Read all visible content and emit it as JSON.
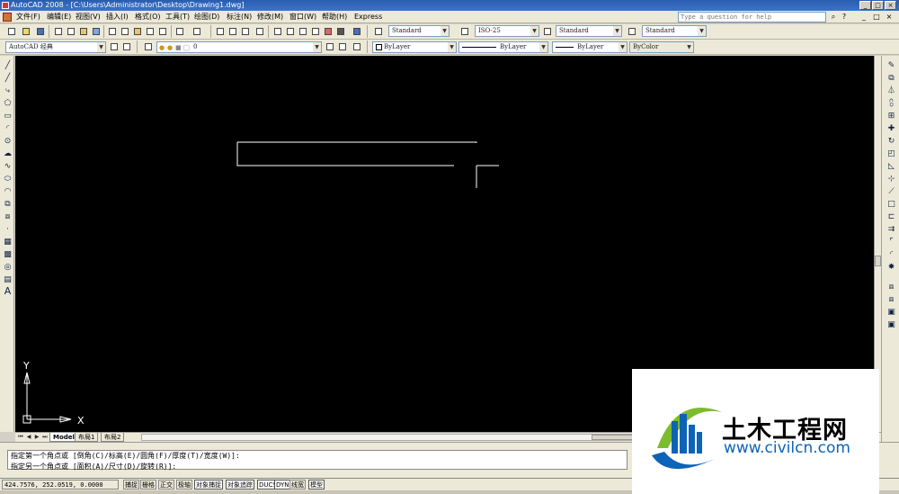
{
  "window": {
    "title": "AutoCAD 2008 - [C:\\Users\\Administrator\\Desktop\\Drawing1.dwg]",
    "controls": [
      "_",
      "□",
      "×"
    ]
  },
  "menubar": {
    "items": [
      "文件(F)",
      "编辑(E)",
      "视图(V)",
      "插入(I)",
      "格式(O)",
      "工具(T)",
      "绘图(D)",
      "标注(N)",
      "修改(M)",
      "窗口(W)",
      "帮助(H)",
      "Express"
    ],
    "help_placeholder": "Type a question for help",
    "doc_controls": [
      "_",
      "□",
      "×"
    ]
  },
  "toolbar1": {
    "text_style": "Standard",
    "dim_style": "ISO-25",
    "table_style": "Standard",
    "mleader_style": "Standard"
  },
  "toolbar2": {
    "workspace": "AutoCAD 经典",
    "layer": "0",
    "color": "ByLayer",
    "linetype": "ByLayer",
    "lineweight": "ByLayer",
    "plotstyle": "ByColor"
  },
  "ucs": {
    "y_label": "Y",
    "x_label": "X"
  },
  "layout_tabs": [
    "Model",
    "布局1",
    "布局2"
  ],
  "command": {
    "line1": "指定第一个角点或 [倒角(C)/标高(E)/圆角(F)/厚度(T)/宽度(W)]:",
    "line2": "指定另一个角点或 [面积(A)/尺寸(D)/旋转(R)]:"
  },
  "status": {
    "coords": "424.7576, 252.0519, 0.0000",
    "buttons": [
      "捕捉",
      "栅格",
      "正交",
      "极轴",
      "对象捕捉",
      "对象追踪",
      "DUCS",
      "DYN",
      "线宽",
      "模型"
    ]
  },
  "watermark": {
    "brand": "土木工程网",
    "url": "www.civilcn.com"
  },
  "colors": {
    "canvas": "#000000",
    "titlebar": "#2a5db0",
    "watermark_blue": "#0d63b7",
    "watermark_green": "#7dbb2f"
  }
}
